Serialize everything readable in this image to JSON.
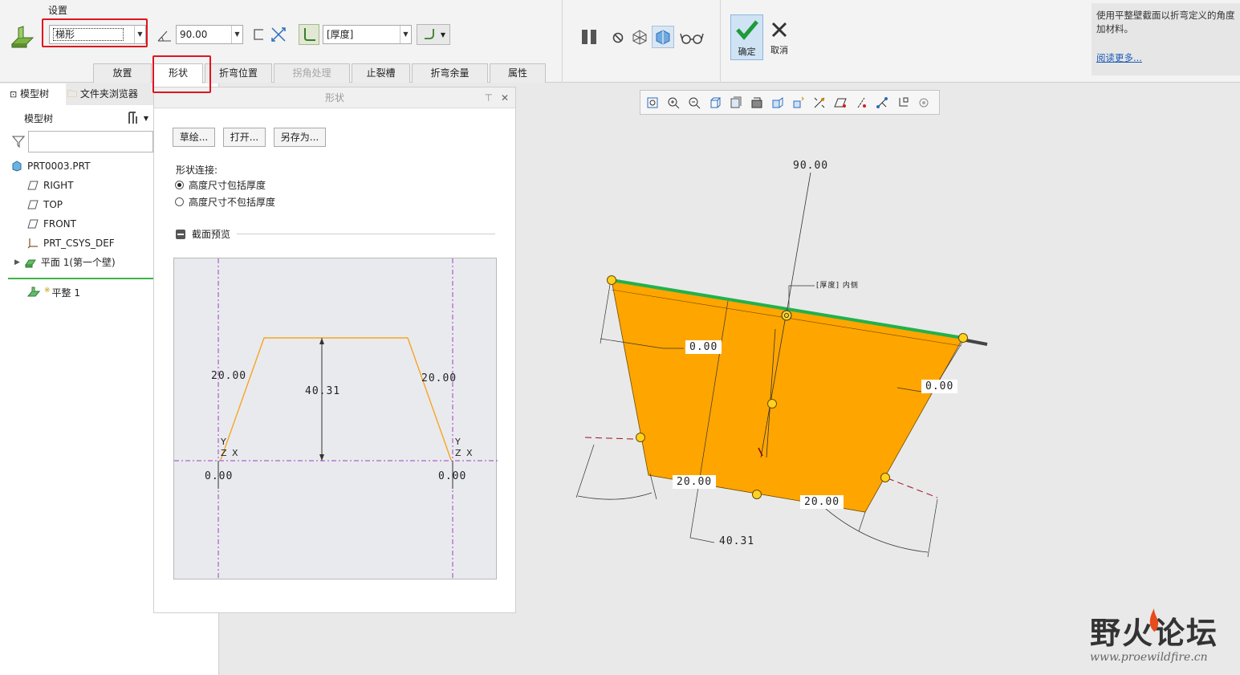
{
  "ribbon": {
    "settings_title": "设置",
    "shape_type": "梯形",
    "angle_value": "90.00",
    "thickness_value": "[厚度]",
    "confirm_label": "确定",
    "cancel_label": "取消",
    "tabs": [
      {
        "label": "放置",
        "state": "normal"
      },
      {
        "label": "形状",
        "state": "active"
      },
      {
        "label": "折弯位置",
        "state": "normal"
      },
      {
        "label": "拐角处理",
        "state": "disabled"
      },
      {
        "label": "止裂槽",
        "state": "normal"
      },
      {
        "label": "折弯余量",
        "state": "normal"
      },
      {
        "label": "属性",
        "state": "normal"
      }
    ],
    "help_text": "使用平整壁截面以折弯定义的角度加材料。",
    "help_link": "阅读更多..."
  },
  "left_panel": {
    "tab_model_tree": "模型树",
    "tab_file_browser": "文件夹浏览器",
    "tree_title": "模型树",
    "filter_placeholder": "",
    "items": [
      {
        "label": "PRT0003.PRT",
        "icon": "part-icon"
      },
      {
        "label": "RIGHT",
        "icon": "datum-plane-icon"
      },
      {
        "label": "TOP",
        "icon": "datum-plane-icon"
      },
      {
        "label": "FRONT",
        "icon": "datum-plane-icon"
      },
      {
        "label": "PRT_CSYS_DEF",
        "icon": "csys-icon"
      },
      {
        "label": "平面 1(第一个壁)",
        "icon": "wall-icon"
      }
    ],
    "insert_item": "平整 1",
    "insert_mark": "※"
  },
  "shape_panel": {
    "title": "形状",
    "btn_sketch": "草绘...",
    "btn_open": "打开...",
    "btn_save_as": "另存为...",
    "connection_label": "形状连接:",
    "option_incl": "高度尺寸包括厚度",
    "option_excl": "高度尺寸不包括厚度",
    "preview_label": "截面预览",
    "preview": {
      "dim_left": "20.00",
      "dim_right": "20.00",
      "dim_height": "40.31",
      "dim_bottom_left": "0.00",
      "dim_bottom_right": "0.00",
      "axis_y": "Y",
      "axis_zx": "Z X"
    }
  },
  "model": {
    "dim_angle": "90.00",
    "thickness_note": "[厚度] 内侧",
    "dim_offset_left": "0.00",
    "dim_offset_right": "0.00",
    "dim_bottom_left": "20.00",
    "dim_bottom_right": "20.00",
    "dim_height": "40.31"
  },
  "watermark": {
    "cn": "野火论坛",
    "url": "www.proewildfire.cn"
  },
  "colors": {
    "accent_red": "#e0141e",
    "wall_orange": "#ffa500",
    "edge_green": "#22b14c",
    "point_yellow": "#ffd21f",
    "sketch_orange": "#f5a623",
    "construction_purple": "#a040c0"
  }
}
